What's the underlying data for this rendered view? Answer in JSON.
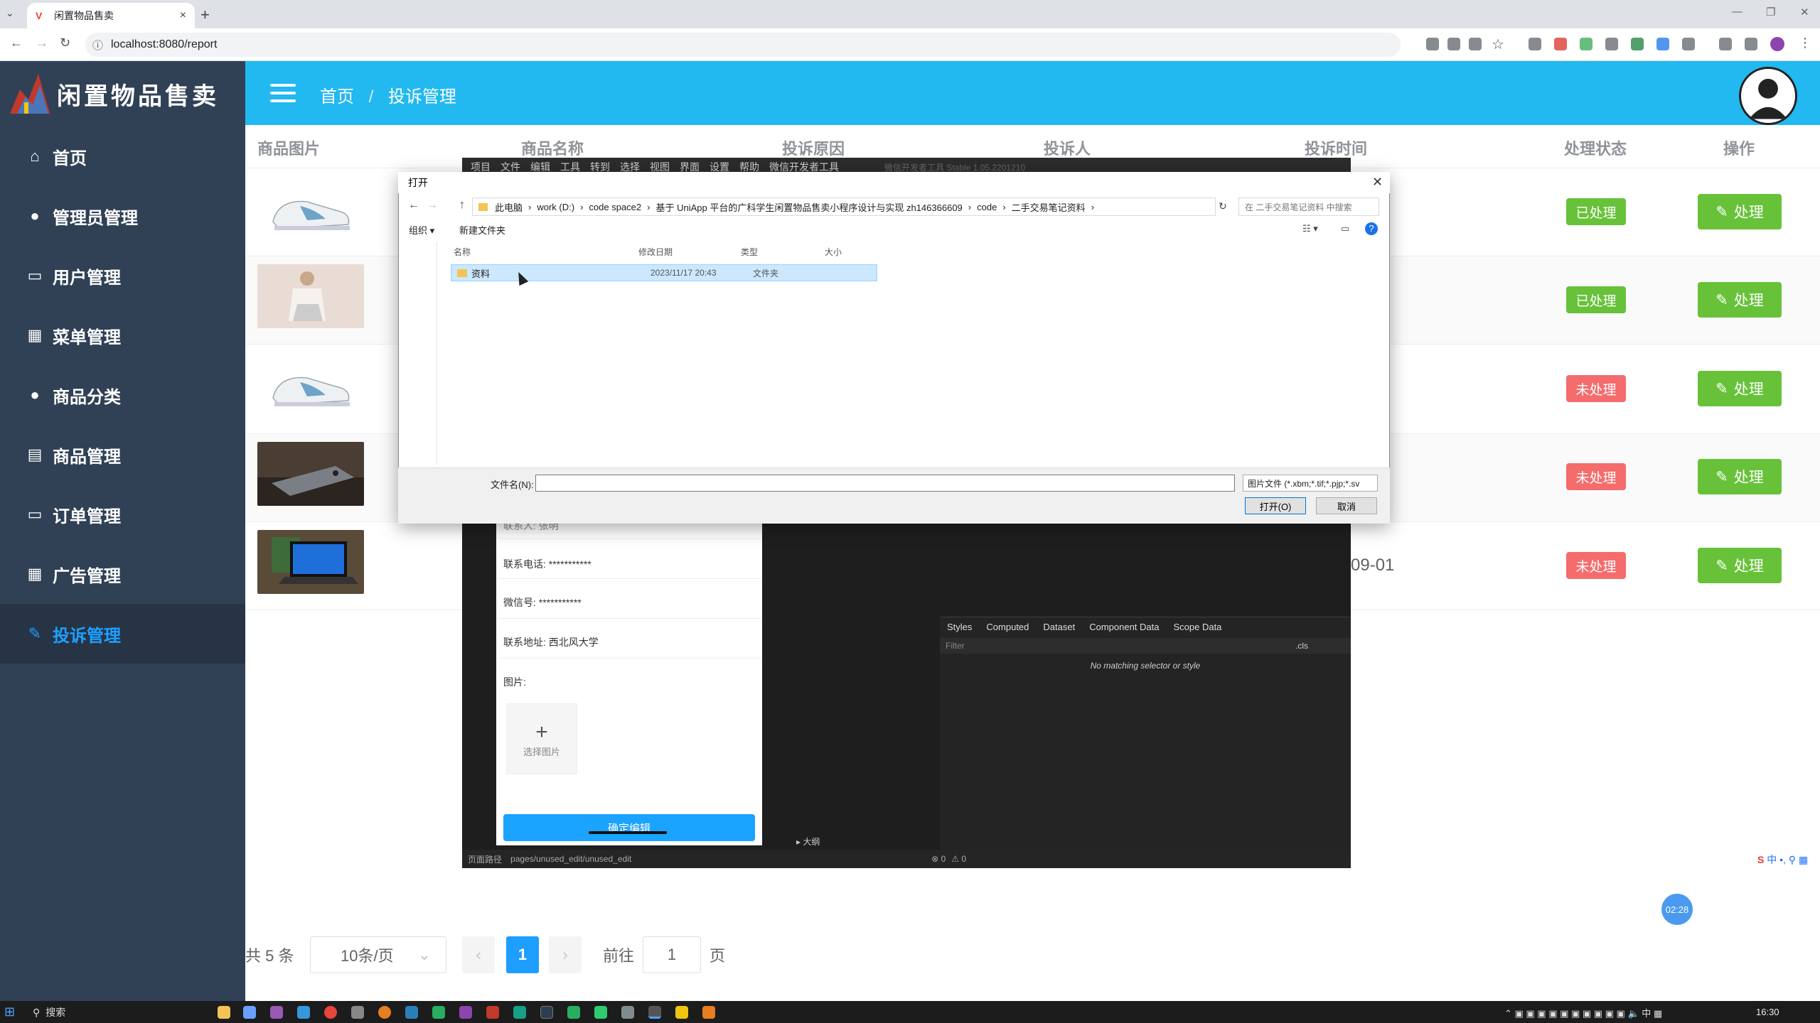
{
  "browser": {
    "tab_title": "闲置物品售卖",
    "url": "localhost:8080/report"
  },
  "app": {
    "logo_text": "闲置物品售卖",
    "breadcrumb": [
      "首页",
      "投诉管理"
    ],
    "breadcrumb_sep": "/"
  },
  "sidebar": {
    "items": [
      {
        "label": "首页",
        "icon": "home-icon"
      },
      {
        "label": "管理员管理",
        "icon": "user-icon"
      },
      {
        "label": "用户管理",
        "icon": "folder-icon"
      },
      {
        "label": "菜单管理",
        "icon": "grid-icon"
      },
      {
        "label": "商品分类",
        "icon": "user-icon"
      },
      {
        "label": "商品管理",
        "icon": "document-icon"
      },
      {
        "label": "订单管理",
        "icon": "monitor-icon"
      },
      {
        "label": "广告管理",
        "icon": "calendar-icon"
      },
      {
        "label": "投诉管理",
        "icon": "edit-icon",
        "active": true
      }
    ]
  },
  "table": {
    "headers": [
      "商品图片",
      "商品名称",
      "投诉原因",
      "投诉人",
      "投诉时间",
      "处理状态",
      "操作"
    ],
    "rows": [
      {
        "image": "sneaker",
        "status": "已处理",
        "status_type": "done",
        "action": "处理"
      },
      {
        "image": "clothing",
        "status": "已处理",
        "status_type": "done",
        "action": "处理"
      },
      {
        "image": "sneaker",
        "status": "未处理",
        "status_type": "todo",
        "action": "处理"
      },
      {
        "image": "phone",
        "status": "未处理",
        "status_type": "todo",
        "action": "处理"
      },
      {
        "image": "laptop",
        "status": "未处理",
        "status_type": "todo",
        "action": "处理",
        "time_partial": "09-01"
      }
    ]
  },
  "pager": {
    "total": "共 5 条",
    "page_size": "10条/页",
    "current": "1",
    "goto_label": "前往",
    "goto_value": "1",
    "page_unit": "页"
  },
  "devtools": {
    "menu": [
      "项目",
      "文件",
      "编辑",
      "工具",
      "转到",
      "选择",
      "视图",
      "界面",
      "设置",
      "帮助",
      "微信开发者工具"
    ],
    "title": "微信开发者工具 Stable 1.05.2201210",
    "phone_lines": [
      "联系电话: ***********",
      "微信号: ***********",
      "联系地址: 西北风大学",
      "图片:"
    ],
    "phone_top_partial": "联系人: 张明",
    "pick_image": "选择图片",
    "confirm": "确定编辑",
    "path_label": "页面路径",
    "path": "pages/unused_edit/unused_edit",
    "tabs": [
      "Styles",
      "Computed",
      "Dataset",
      "Component Data",
      "Scope Data"
    ],
    "filter": "Filter",
    "cls": ".cls",
    "no_match": "No matching selector or style",
    "outline": "大纲",
    "errors": "0",
    "warnings": "0"
  },
  "dialog": {
    "title": "打开",
    "path": [
      "此电脑",
      "work (D:)",
      "code space2",
      "基于 UniApp 平台的广科学生闲置物品售卖小程序设计与实现 zh146366609",
      "code",
      "二手交易笔记资料"
    ],
    "search_placeholder": "在 二手交易笔记资料 中搜索",
    "organize": "组织 ▾",
    "new_folder": "新建文件夹",
    "columns": [
      "名称",
      "修改日期",
      "类型",
      "大小"
    ],
    "file": {
      "name": "资料",
      "date": "2023/11/17 20:43",
      "type": "文件夹"
    },
    "filename_label": "文件名(N):",
    "filetype": "图片文件 (*.xbm;*.tif;*.pjp;*.sv",
    "open_btn": "打开(O)",
    "cancel_btn": "取消"
  },
  "taskbar": {
    "search": "搜索",
    "time": "16:30",
    "ime": "中"
  },
  "timer_badge": "02:28"
}
